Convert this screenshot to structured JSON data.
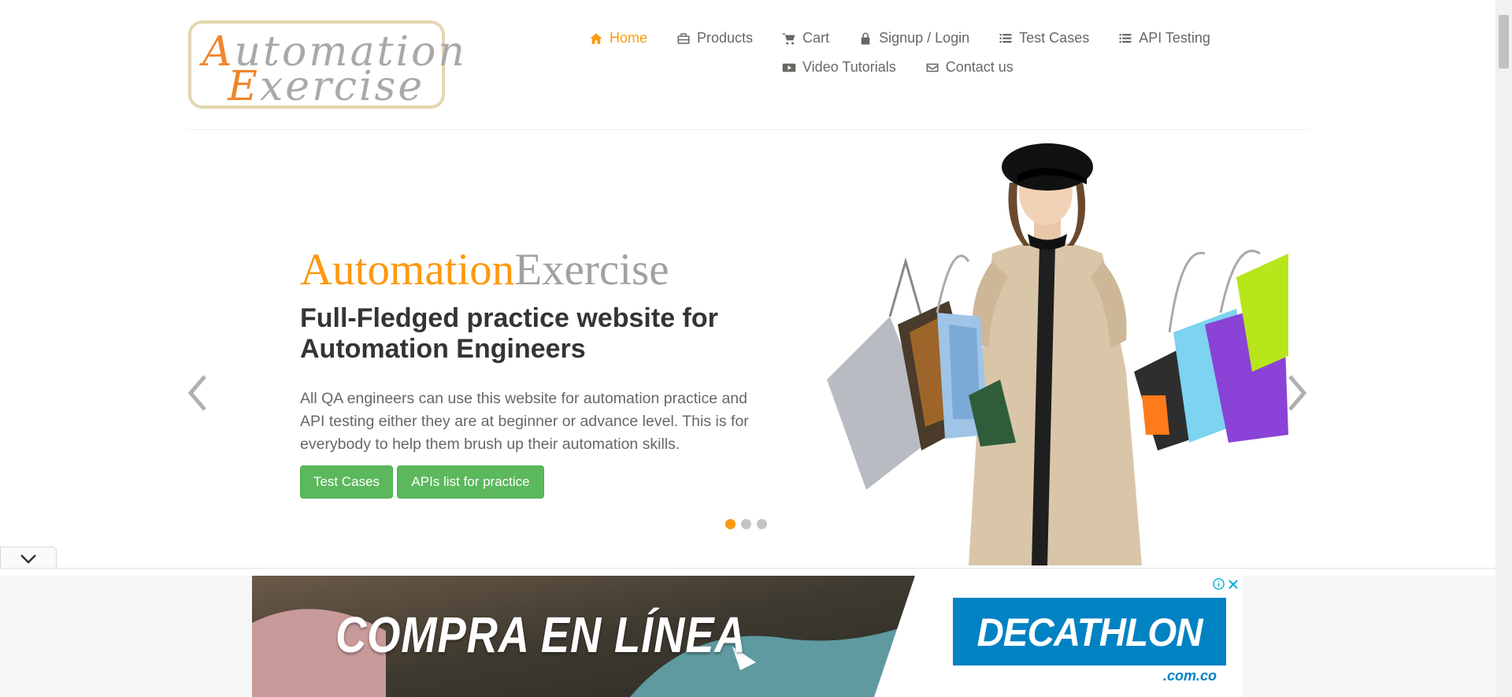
{
  "logo": {
    "line1_cap": "A",
    "line1_rest": "utomation",
    "line2_cap": "E",
    "line2_rest": "xercise"
  },
  "nav": {
    "row1": [
      {
        "label": "Home",
        "icon": "home-icon",
        "active": true
      },
      {
        "label": "Products",
        "icon": "briefcase-icon"
      },
      {
        "label": "Cart",
        "icon": "cart-icon"
      },
      {
        "label": "Signup / Login",
        "icon": "lock-icon"
      },
      {
        "label": "Test Cases",
        "icon": "list-icon"
      },
      {
        "label": "API Testing",
        "icon": "list-icon"
      }
    ],
    "row2": [
      {
        "label": "Video Tutorials",
        "icon": "youtube-play-icon"
      },
      {
        "label": "Contact us",
        "icon": "envelope-icon"
      }
    ]
  },
  "hero": {
    "brand_part1": "Automation",
    "brand_part2": "Exercise",
    "heading": "Full-Fledged practice website for Automation Engineers",
    "description": "All QA engineers can use this website for automation practice and API testing either they are at beginner or advance level. This is for everybody to help them brush up their automation skills.",
    "btn_test_cases": "Test Cases",
    "btn_apis": "APIs list for practice",
    "slides_total": 3,
    "active_slide": 1
  },
  "ad": {
    "headline": "COMPRA EN LÍNEA",
    "brand": "DECATHLON",
    "domain": ".com.co"
  },
  "colors": {
    "accent": "#FE980F",
    "button_green": "#5cb85c",
    "text": "#696763",
    "heading": "#363432",
    "decathlon_blue": "#0082c3"
  }
}
